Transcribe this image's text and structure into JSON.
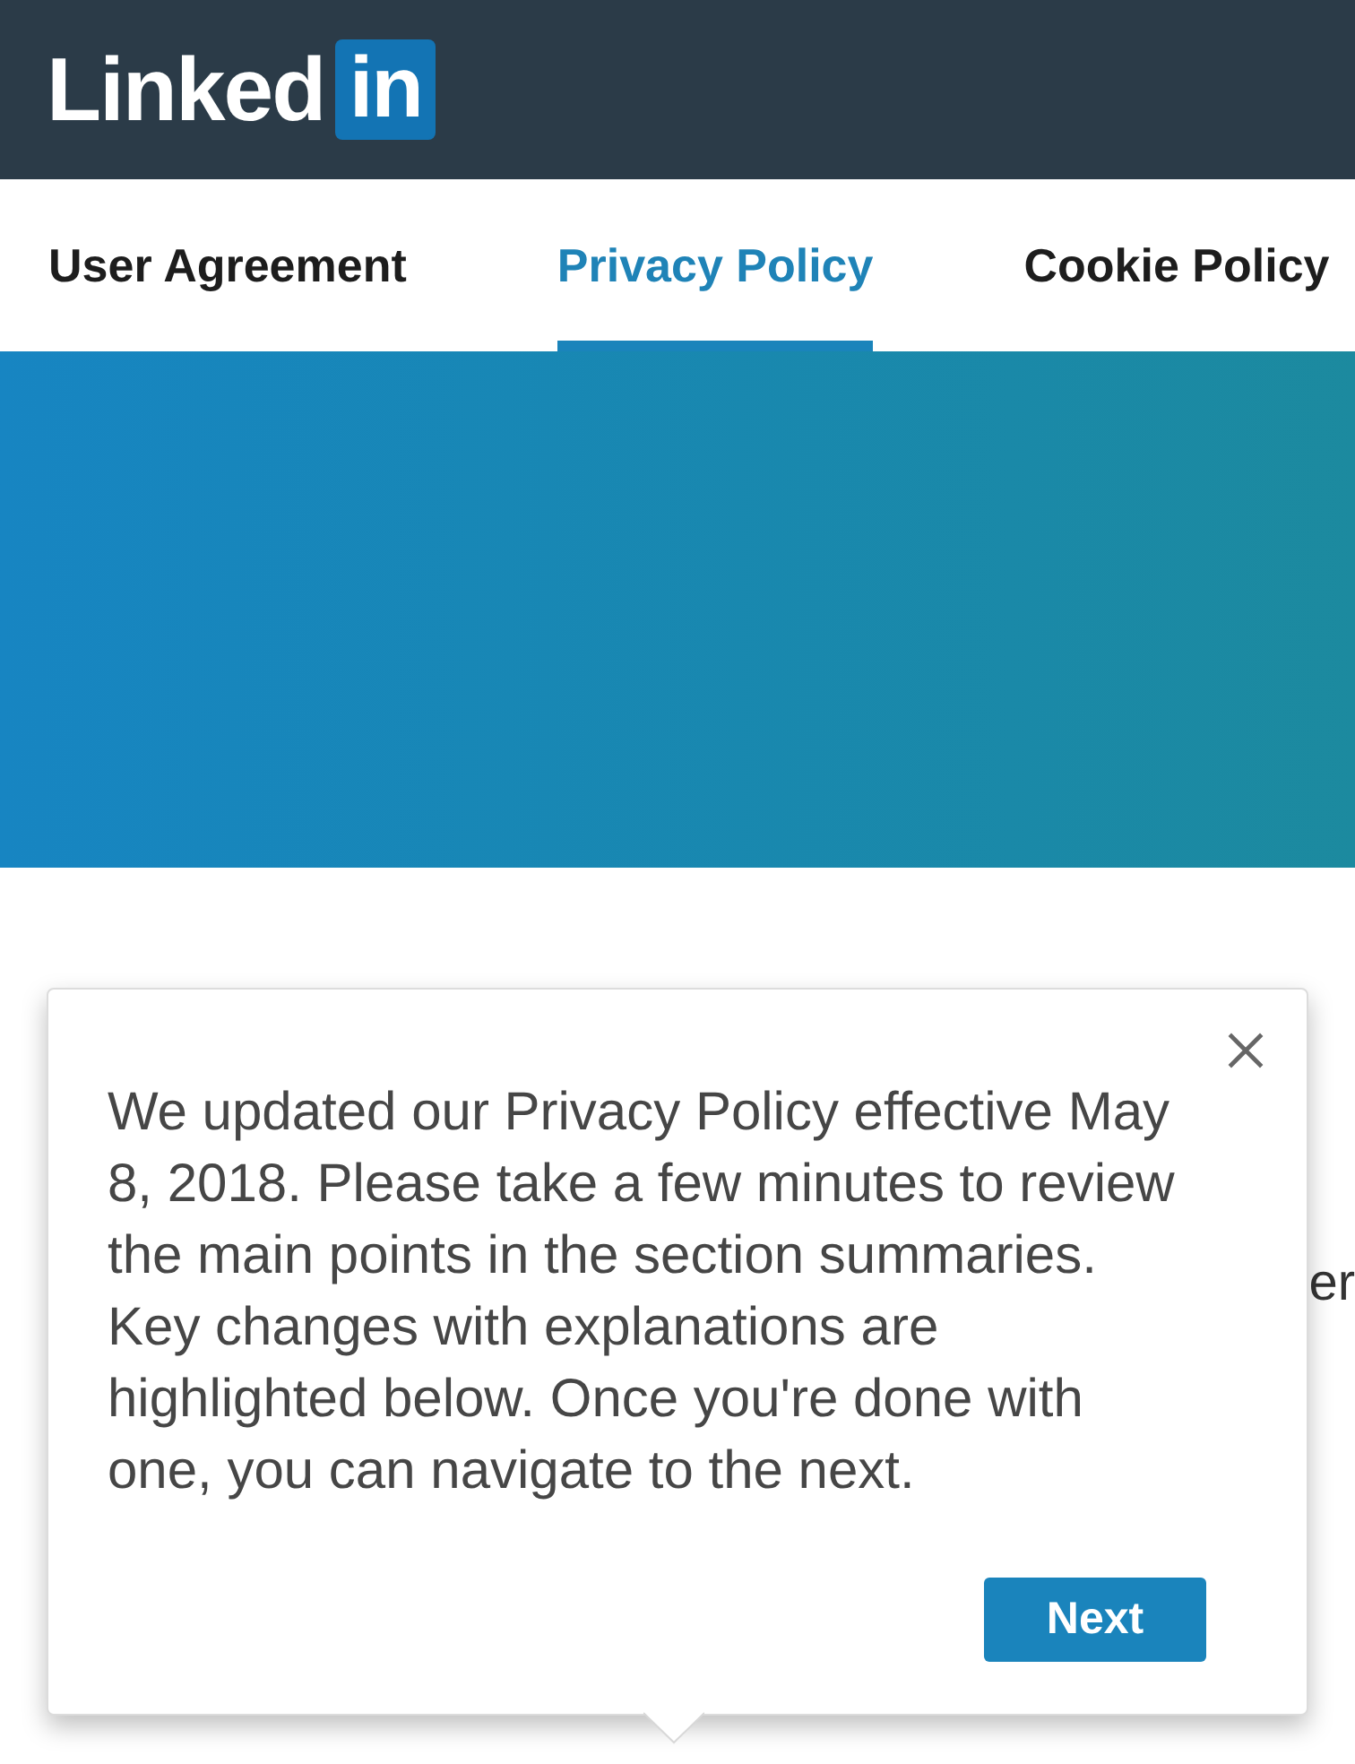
{
  "header": {
    "logo": {
      "wordmark": "Linked",
      "badge": "in"
    }
  },
  "tabs": [
    {
      "label": "User Agreement",
      "selected": false
    },
    {
      "label": "Privacy Policy",
      "selected": true
    },
    {
      "label": "Cookie Policy",
      "selected": false
    }
  ],
  "page_text_fragment": "er",
  "tour_popup": {
    "message": "We updated our Privacy Policy effective May 8, 2018. Please take a few minutes to review the main points in the section summaries. Key changes with explanations are highlighted below. Once you're done with one, you can navigate to the next.",
    "button": "Next"
  }
}
